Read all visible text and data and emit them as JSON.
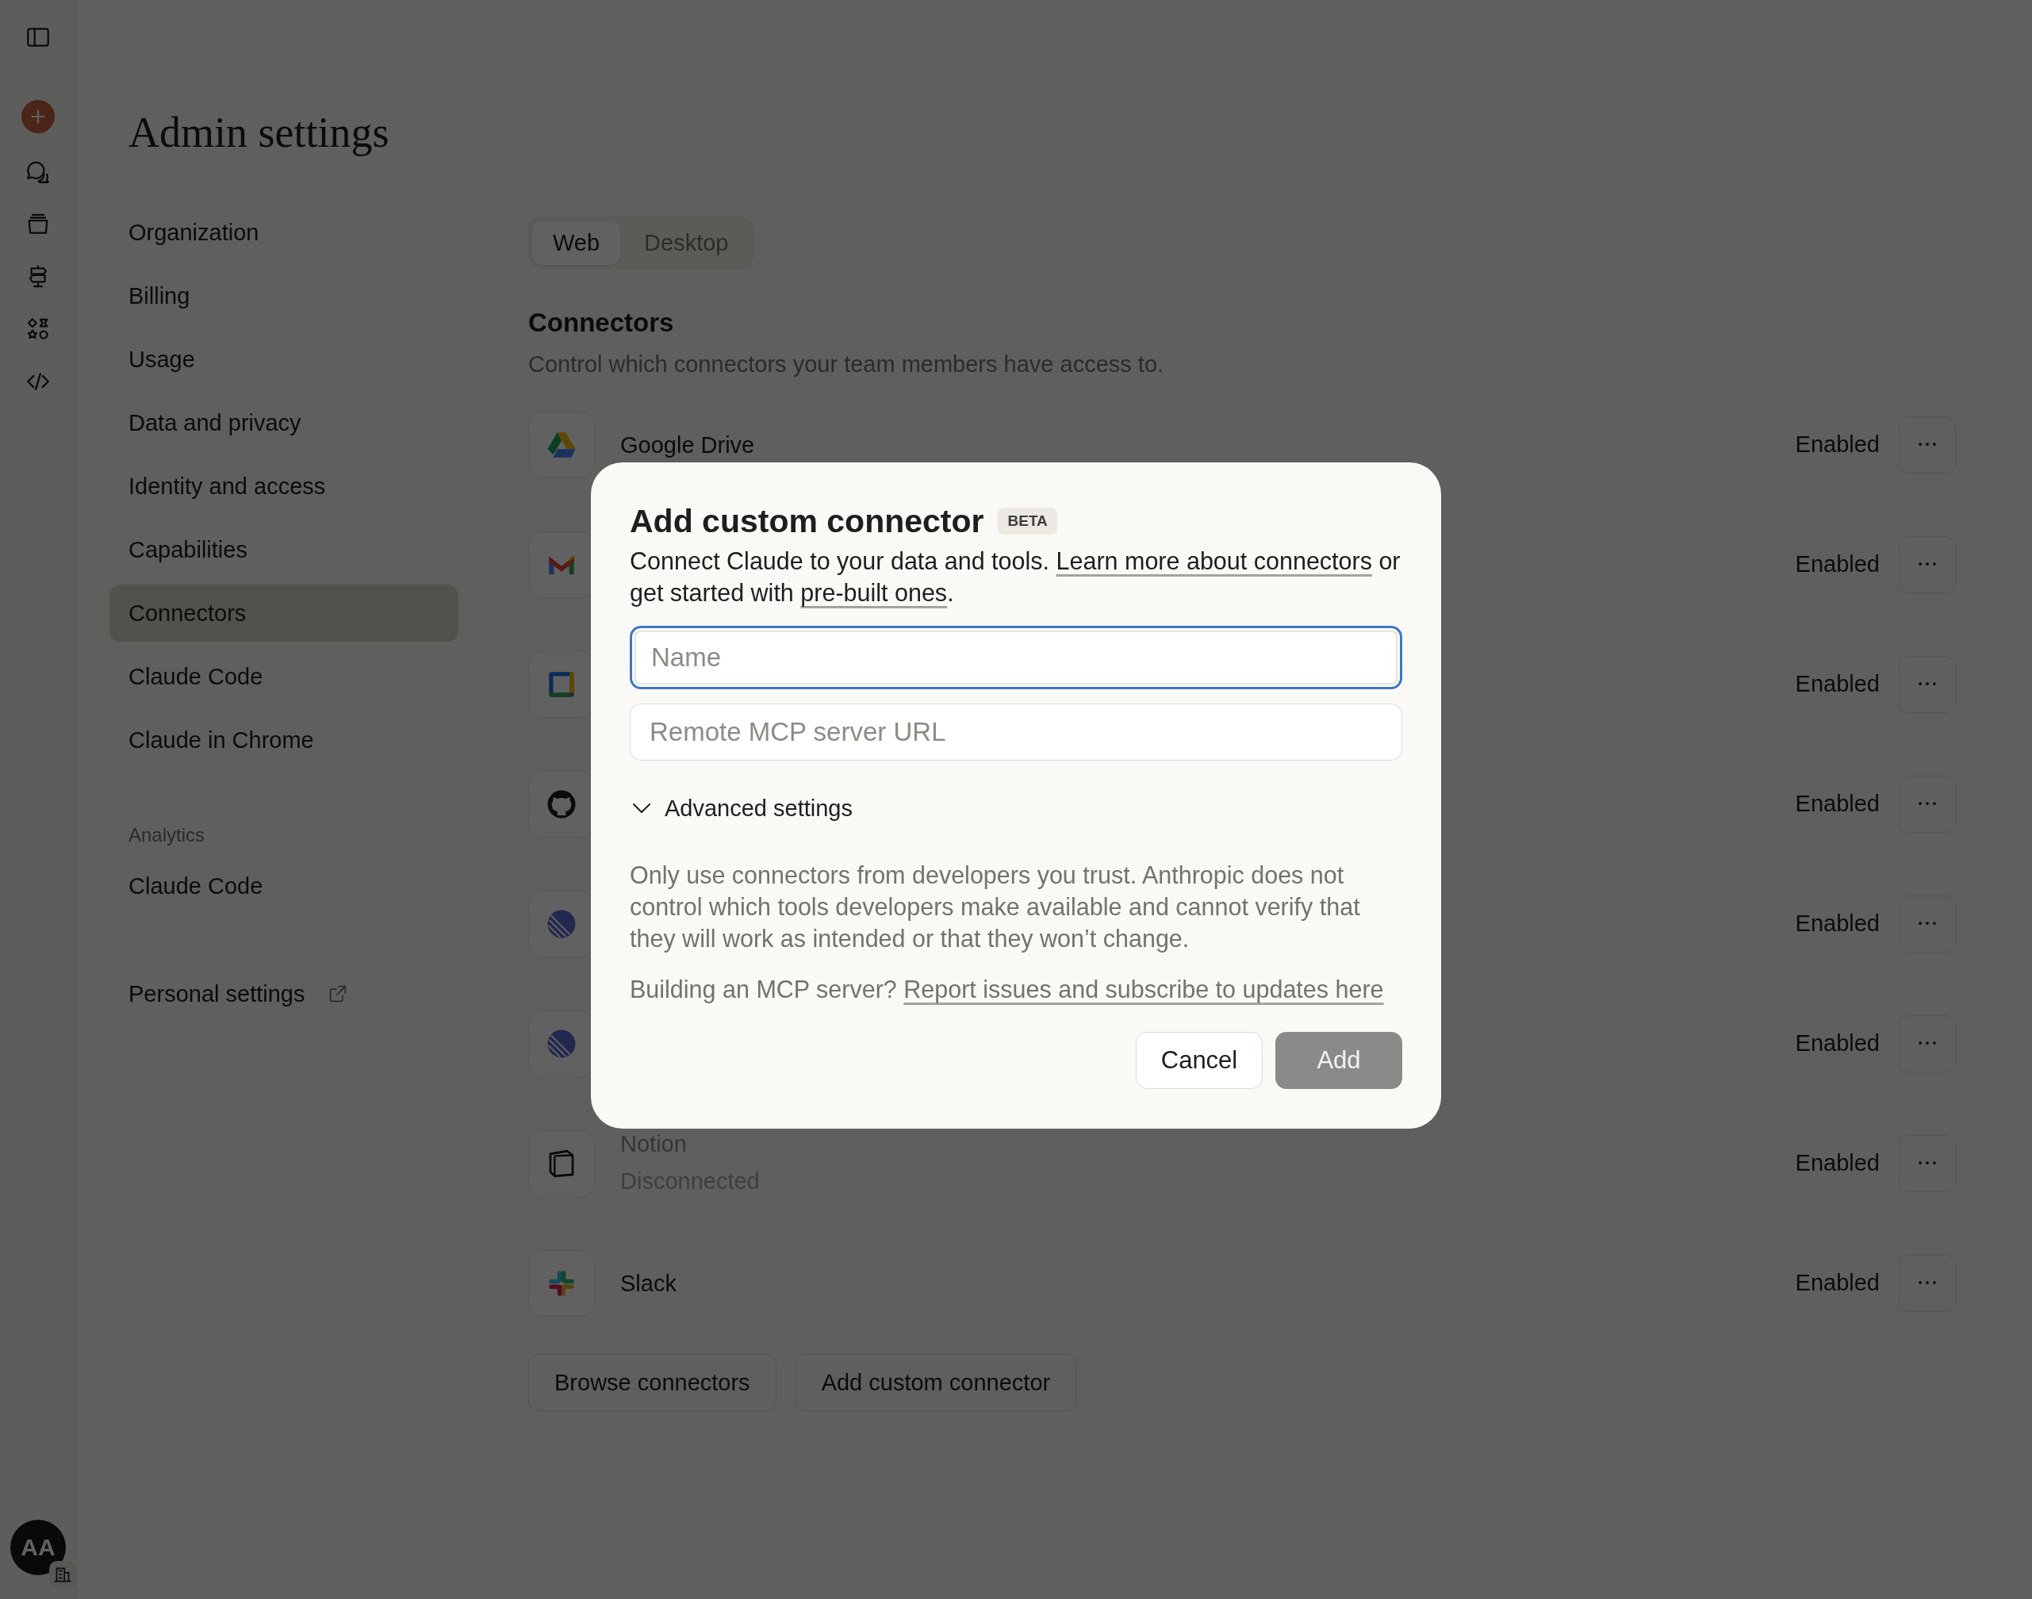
{
  "rail": {
    "avatar": {
      "initials": "AA"
    }
  },
  "page_title": "Admin settings",
  "nav": {
    "items": [
      {
        "label": "Organization",
        "selected": false
      },
      {
        "label": "Billing",
        "selected": false
      },
      {
        "label": "Usage",
        "selected": false
      },
      {
        "label": "Data and privacy",
        "selected": false
      },
      {
        "label": "Identity and access",
        "selected": false
      },
      {
        "label": "Capabilities",
        "selected": false
      },
      {
        "label": "Connectors",
        "selected": true
      },
      {
        "label": "Claude Code",
        "selected": false
      },
      {
        "label": "Claude in Chrome",
        "selected": false
      }
    ],
    "analytics_heading": "Analytics",
    "analytics_items": [
      {
        "label": "Claude Code",
        "selected": false
      }
    ],
    "personal_settings": "Personal settings"
  },
  "tabs": [
    {
      "label": "Web",
      "selected": true
    },
    {
      "label": "Desktop",
      "selected": false
    }
  ],
  "connectors": {
    "title": "Connectors",
    "description": "Control which connectors your team members have access to.",
    "items": [
      {
        "kind": "drive",
        "name": "Google Drive",
        "connected": true,
        "status": "Enabled"
      },
      {
        "kind": "gmail",
        "status": "Enabled"
      },
      {
        "kind": "calendar",
        "status": "Enabled"
      },
      {
        "kind": "github",
        "status": "Enabled"
      },
      {
        "kind": "linear",
        "status": "Enabled"
      },
      {
        "kind": "linear",
        "status": "Enabled"
      },
      {
        "kind": "notion",
        "name": "Notion",
        "subtitle": "Disconnected",
        "connected": false,
        "status": "Enabled"
      },
      {
        "kind": "slack",
        "name": "Slack",
        "connected": true,
        "status": "Enabled"
      }
    ],
    "buttons": [
      "Browse connectors",
      "Add custom connector"
    ]
  },
  "modal": {
    "title": "Add custom connector",
    "badge": "BETA",
    "description": [
      {
        "kind": "text",
        "text": "Connect Claude to your data and tools. "
      },
      {
        "kind": "link",
        "text": "Learn more about connectors"
      },
      {
        "kind": "text",
        "text": " or get started with "
      },
      {
        "kind": "link",
        "text": "pre-built ones"
      },
      {
        "kind": "text",
        "text": "."
      }
    ],
    "fields": [
      {
        "placeholder": "Name",
        "focused": true
      },
      {
        "placeholder": "Remote MCP server URL",
        "focused": false
      }
    ],
    "advanced": {
      "label": "Advanced settings",
      "expanded": false
    },
    "warning": "Only use connectors from developers you trust. Anthropic does not control which tools developers make available and cannot verify that they will work as intended or that they won’t change.",
    "building": [
      {
        "kind": "text",
        "text": "Building an MCP server? "
      },
      {
        "kind": "link",
        "text": "Report issues and subscribe to updates here"
      }
    ],
    "buttons": [
      {
        "label": "Cancel",
        "kind": "secondary",
        "disabled": false
      },
      {
        "label": "Add",
        "kind": "primary",
        "disabled": true
      }
    ]
  }
}
